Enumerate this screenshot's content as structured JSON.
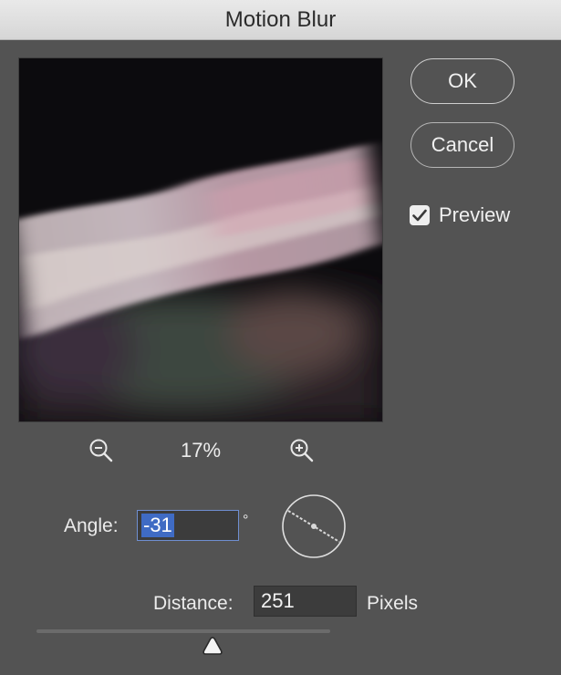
{
  "window": {
    "title": "Motion Blur"
  },
  "buttons": {
    "ok_label": "OK",
    "cancel_label": "Cancel"
  },
  "preview_toggle": {
    "label": "Preview",
    "checked": true
  },
  "zoom": {
    "level": "17%",
    "zoom_out_icon": "zoom-out-icon",
    "zoom_in_icon": "zoom-in-icon"
  },
  "angle": {
    "label": "Angle:",
    "value": "-31",
    "unit": "°",
    "dial_icon": "angle-dial-icon"
  },
  "distance": {
    "label": "Distance:",
    "value": "251",
    "unit": "Pixels",
    "slider_fraction": 0.6
  },
  "colors": {
    "dialog_bg": "#535353",
    "titlebar_bg": "#dcdcdc",
    "selection": "#3f6bc4",
    "focus_border": "#6f8fd1"
  }
}
